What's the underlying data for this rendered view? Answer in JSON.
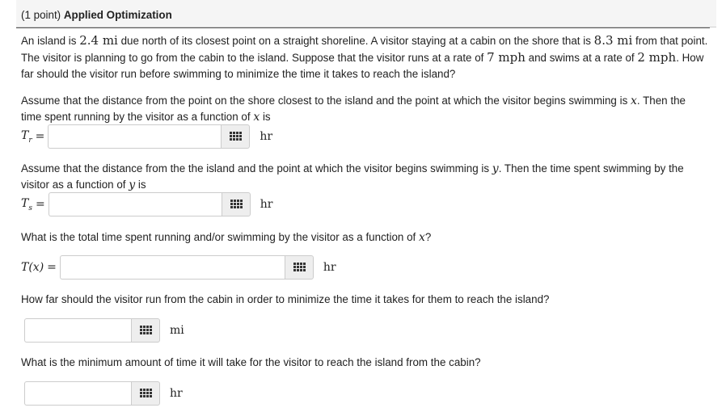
{
  "header": {
    "points": "(1 point)",
    "title": "Applied Optimization"
  },
  "problem": {
    "s1": "An island is ",
    "island_dist": "2.4 mi",
    "s2": " due north of its closest point on a straight shoreline. A visitor staying at a cabin on the shore that is ",
    "cabin_dist": "8.3 mi",
    "s3": " from that point. The visitor is planning to go from the cabin to the island. Suppose that the visitor runs at a rate of ",
    "run_rate": "7 mph",
    "s4": " and swims at a rate of ",
    "swim_rate": "2 mph",
    "s5": ". How far should the visitor run before swimming to minimize the time it takes to reach the island?"
  },
  "q1": {
    "text_a": "Assume that the distance from the point on the shore closest to the island and the point at which the visitor begins swimming is ",
    "var": "x",
    "text_b": ". Then the time spent running by the visitor as a function of ",
    "text_c": " is",
    "lhs": "T",
    "lhs_sub": "r",
    "eq": "=",
    "value": "",
    "unit": "hr"
  },
  "q2": {
    "text_a": "Assume that the distance from the the island and the point at which the visitor begins swimming is ",
    "var": "y",
    "text_b": ". Then the time spent swimming by the visitor as a function of ",
    "text_c": " is",
    "lhs": "T",
    "lhs_sub": "s",
    "eq": "=",
    "value": "",
    "unit": "hr"
  },
  "q3": {
    "text_a": "What is the total time spent running and/or swimming by the visitor as a function of ",
    "var": "x",
    "text_b": "?",
    "lhs": "T(x)",
    "eq": "=",
    "value": "",
    "unit": "hr"
  },
  "q4": {
    "text": "How far should the visitor run from the cabin in order to minimize the time it takes for them to reach the island?",
    "value": "",
    "unit": "mi"
  },
  "q5": {
    "text": "What is the minimum amount of time it will take for the visitor to reach the island from the cabin?",
    "value": "",
    "unit": "hr"
  },
  "icons": {
    "equation_editor": "grid-icon"
  }
}
